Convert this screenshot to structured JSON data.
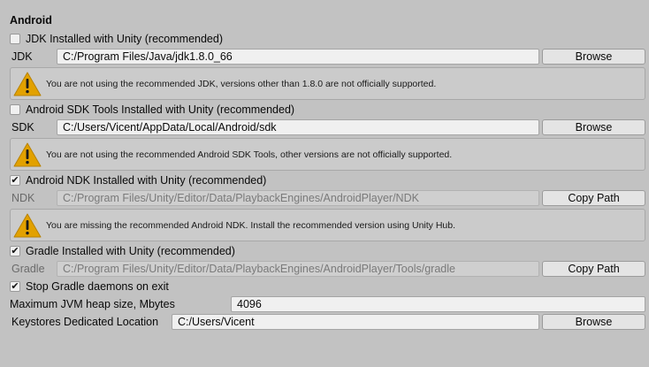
{
  "section": {
    "title": "Android"
  },
  "jdk": {
    "checkbox_label": "JDK Installed with Unity (recommended)",
    "checked": false,
    "field_label": "JDK",
    "path": "C:/Program Files/Java/jdk1.8.0_66",
    "button": "Browse",
    "warning": "You are not using the recommended JDK, versions other than 1.8.0 are not officially supported."
  },
  "sdk": {
    "checkbox_label": "Android SDK Tools Installed with Unity (recommended)",
    "checked": false,
    "field_label": "SDK",
    "path": "C:/Users/Vicent/AppData/Local/Android/sdk",
    "button": "Browse",
    "warning": "You are not using the recommended Android SDK Tools, other versions are not officially supported."
  },
  "ndk": {
    "checkbox_label": "Android NDK Installed with Unity (recommended)",
    "checked": true,
    "field_label": "NDK",
    "path": "C:/Program Files/Unity/Editor/Data/PlaybackEngines/AndroidPlayer/NDK",
    "button": "Copy Path",
    "warning": "You are missing the recommended Android NDK. Install the recommended version using Unity Hub."
  },
  "gradle": {
    "checkbox_label": "Gradle Installed with Unity (recommended)",
    "checked": true,
    "field_label": "Gradle",
    "path": "C:/Program Files/Unity/Editor/Data/PlaybackEngines/AndroidPlayer/Tools/gradle",
    "button": "Copy Path"
  },
  "stop_gradle": {
    "checkbox_label": "Stop Gradle daemons on exit",
    "checked": true
  },
  "jvm_heap": {
    "label": "Maximum JVM heap size, Mbytes",
    "value": "4096"
  },
  "keystores": {
    "label": "Keystores Dedicated Location",
    "value": "C:/Users/Vicent",
    "button": "Browse"
  },
  "icons": {
    "warning": "warning-triangle-icon",
    "check": "checkmark-icon"
  },
  "colors": {
    "background": "#c2c2c2",
    "warning_yellow": "#e2a100"
  }
}
